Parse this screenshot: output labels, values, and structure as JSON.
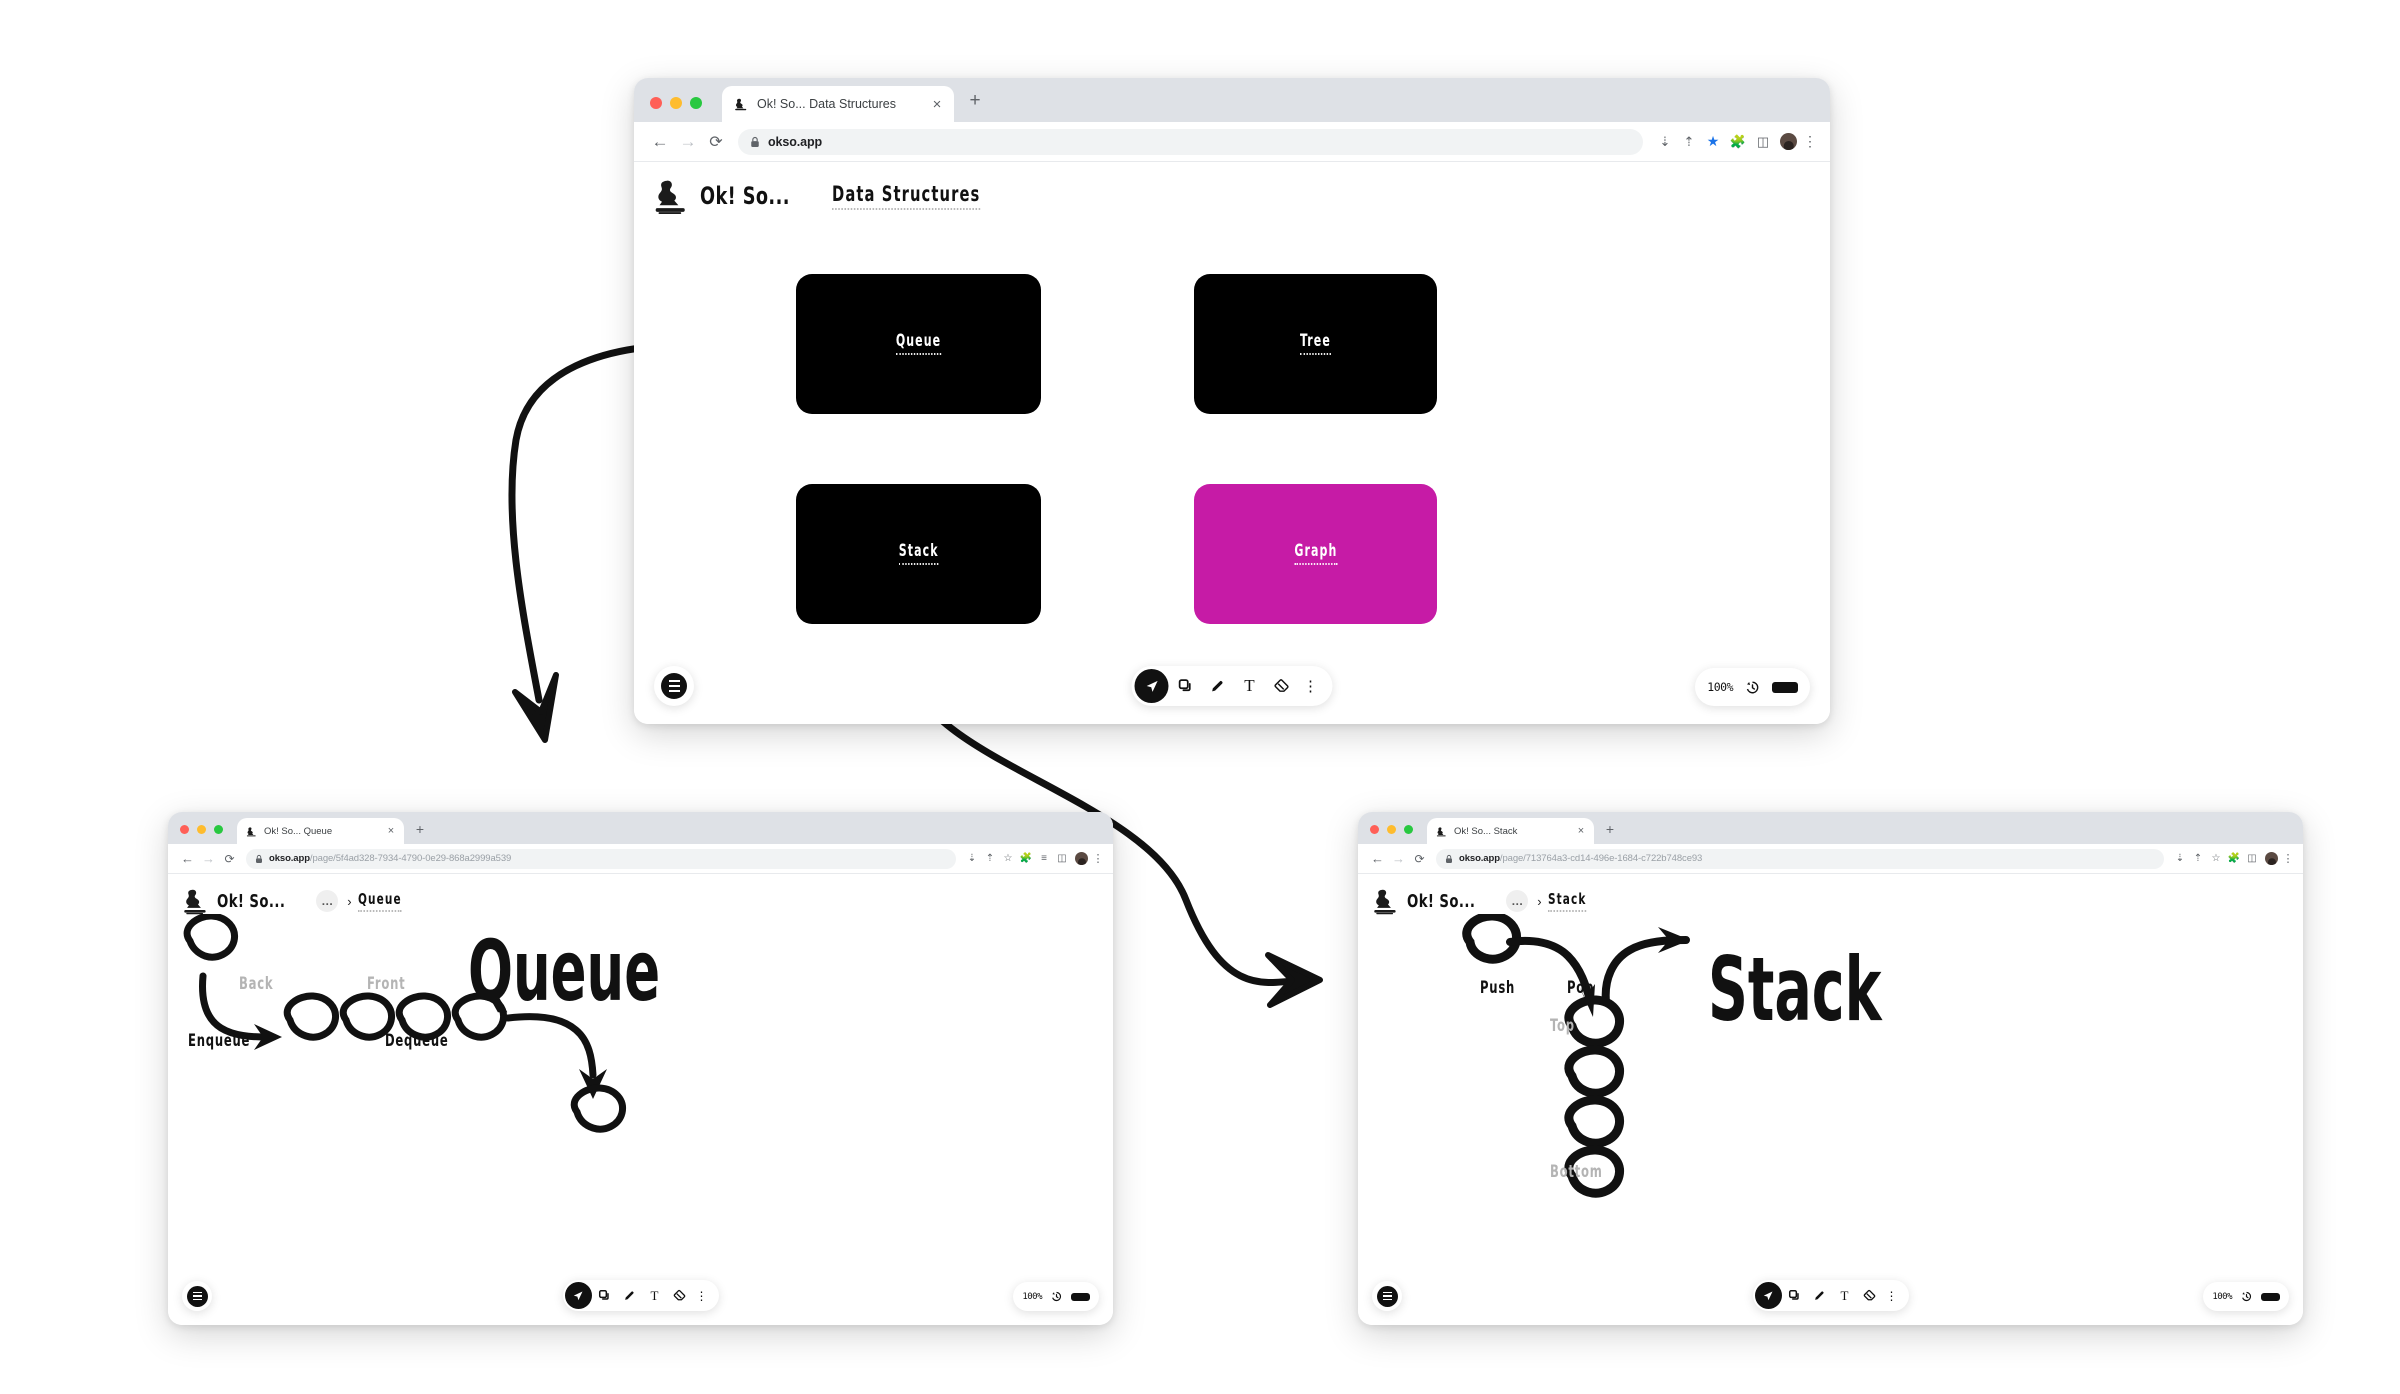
{
  "colors": {
    "card_black": "#000000",
    "card_magenta": "#C61BA6",
    "accent_bookmark": "#1a73e8",
    "label_gray": "#b4b4b4"
  },
  "main_window": {
    "tab": {
      "title": "Ok! So... Data Structures",
      "close_glyph": "×",
      "newtab_glyph": "+",
      "caret_glyph": "⌄"
    },
    "omnibox": {
      "back_glyph": "←",
      "forward_glyph": "→",
      "reload_glyph": "⟳",
      "url": "okso.app",
      "url_path": ""
    },
    "app": {
      "brand": "Ok! So...",
      "page_title": "Data Structures"
    },
    "cards": [
      {
        "label": "Queue",
        "color": "#000000"
      },
      {
        "label": "Tree",
        "color": "#C61BA6"
      },
      {
        "label": "Stack",
        "color": "#000000"
      },
      {
        "label": "Graph",
        "color": "#C61BA6"
      }
    ],
    "toolbar": {
      "menu_name": "hamburger-menu",
      "tools": [
        "select",
        "shape",
        "pencil",
        "text",
        "eraser",
        "more"
      ],
      "text_tool_label": "T",
      "more_glyph": "⋮",
      "zoom": "100%"
    }
  },
  "queue_window": {
    "tab": {
      "title": "Ok! So... Queue",
      "close_glyph": "×",
      "newtab_glyph": "+",
      "caret_glyph": "⌄"
    },
    "omnibox": {
      "domain": "okso.app",
      "path": "/page/5f4ad328-7934-4790-0e29-868a2999a539",
      "back_glyph": "←",
      "forward_glyph": "→",
      "reload_glyph": "⟳"
    },
    "app": {
      "brand": "Ok! So...",
      "crumb_ellipsis": "…",
      "crumb_sep": "›",
      "crumb_title": "Queue"
    },
    "drawing": {
      "title": "Queue",
      "labels": {
        "enqueue": "Enqueue",
        "dequeue": "Dequeue",
        "back": "Back",
        "front": "Front"
      },
      "node_count": 4
    },
    "toolbar": {
      "zoom": "100%",
      "text_tool_label": "T",
      "more_glyph": "⋮"
    }
  },
  "stack_window": {
    "tab": {
      "title": "Ok! So... Stack",
      "close_glyph": "×",
      "newtab_glyph": "+",
      "caret_glyph": "⌄"
    },
    "omnibox": {
      "domain": "okso.app",
      "path": "/page/713764a3-cd14-496e-1684-c722b748ce93",
      "back_glyph": "←",
      "forward_glyph": "→",
      "reload_glyph": "⟳"
    },
    "app": {
      "brand": "Ok! So...",
      "crumb_ellipsis": "…",
      "crumb_sep": "›",
      "crumb_title": "Stack"
    },
    "drawing": {
      "title": "Stack",
      "labels": {
        "push": "Push",
        "pop": "Pop",
        "top": "Top",
        "bottom": "Bottom"
      },
      "node_count": 4
    },
    "toolbar": {
      "zoom": "100%",
      "text_tool_label": "T",
      "more_glyph": "⋮"
    }
  }
}
